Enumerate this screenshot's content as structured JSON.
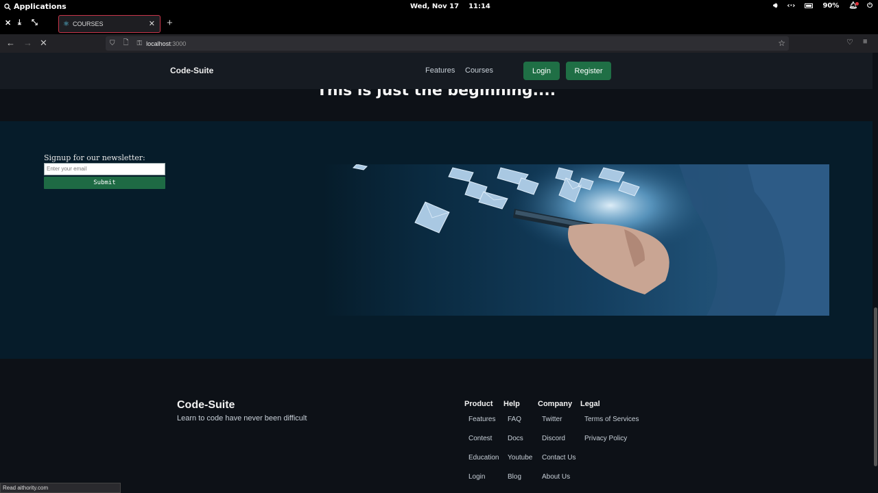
{
  "os": {
    "apps_label": "Applications",
    "date": "Wed, Nov 17",
    "time": "11:14",
    "battery": "90%"
  },
  "browser": {
    "tab_title": "COURSES",
    "url_host": "localhost",
    "url_port": ":3000",
    "status_text": "Read aithority.com"
  },
  "site": {
    "logo": "Code-Suite",
    "nav": [
      "Features",
      "Courses"
    ],
    "login_label": "Login",
    "register_label": "Register",
    "headline": "This is just the beginning...."
  },
  "newsletter": {
    "label": "Signup for our newsletter:",
    "placeholder": "Enter your email",
    "submit": "Submit"
  },
  "footer": {
    "logo": "Code-Suite",
    "tagline": "Learn to code have never been difficult",
    "columns": [
      {
        "title": "Product",
        "links": [
          "Features",
          "Contest",
          "Education",
          "Login"
        ]
      },
      {
        "title": "Help",
        "links": [
          "FAQ",
          "Docs",
          "Youtube",
          "Blog"
        ]
      },
      {
        "title": "Company",
        "links": [
          "Twitter",
          "Discord",
          "Contact Us",
          "About Us"
        ]
      },
      {
        "title": "Legal",
        "links": [
          "Terms of Services",
          "Privacy Policy"
        ]
      }
    ]
  },
  "colors": {
    "accent_green": "#1f6f45",
    "band_bg": "#061c2a",
    "page_bg": "#0d1117"
  }
}
